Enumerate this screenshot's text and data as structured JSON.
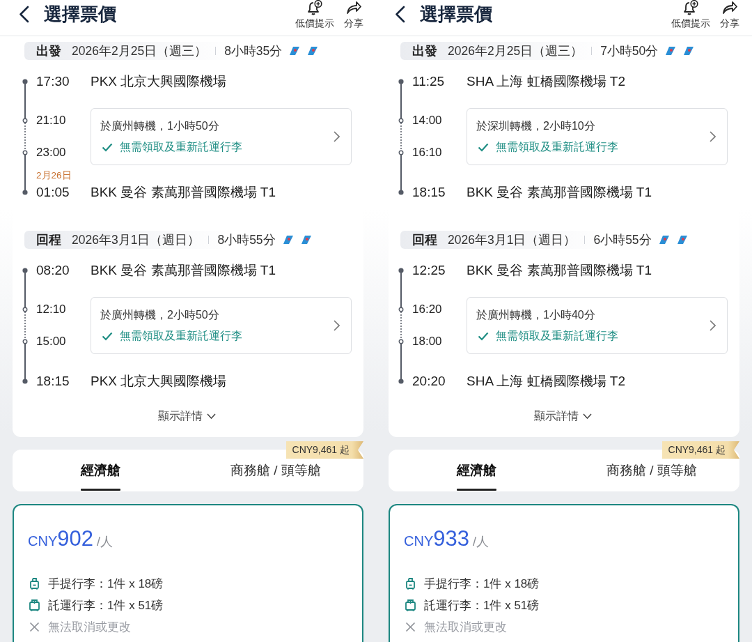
{
  "panels": [
    {
      "header": {
        "title": "選擇票價",
        "actions": [
          {
            "kind": "alert",
            "label": "低價提示"
          },
          {
            "kind": "share",
            "label": "分享"
          }
        ]
      },
      "legs": [
        {
          "label": "出發",
          "date": "2026年2月25日（週三）",
          "duration": "8小時35分",
          "depart": {
            "time": "17:30",
            "airport": "PKX 北京大興國際機場"
          },
          "transfer": {
            "arrive_time": "21:10",
            "depart_time": "23:00",
            "text": "於廣州轉機，1小時50分",
            "note": "無需領取及重新託運行李"
          },
          "arrive": {
            "date_note": "2月26日",
            "time": "01:05",
            "airport": "BKK 曼谷 素萬那普國際機場 T1"
          }
        },
        {
          "label": "回程",
          "date": "2026年3月1日（週日）",
          "duration": "8小時55分",
          "depart": {
            "time": "08:20",
            "airport": "BKK 曼谷 素萬那普國際機場 T1"
          },
          "transfer": {
            "arrive_time": "12:10",
            "depart_time": "15:00",
            "text": "於廣州轉機，2小時50分",
            "note": "無需領取及重新託運行李"
          },
          "arrive": {
            "time": "18:15",
            "airport": "PKX 北京大興國際機場"
          }
        }
      ],
      "details_link": "顯示詳情",
      "cabin_tabs": [
        {
          "label": "經濟艙",
          "selected": true
        },
        {
          "label": "商務艙 / 頭等艙",
          "selected": false
        }
      ],
      "cabin_badge": "CNY9,461 起",
      "fare": {
        "currency": "CNY",
        "amount": "902",
        "unit": "/人",
        "items": [
          {
            "kind": "carry_on",
            "text": "手提行李：1件 x 18磅"
          },
          {
            "kind": "checked_bag",
            "text": "託運行李：1件 x 51磅"
          },
          {
            "kind": "no_change",
            "text": "無法取消或更改"
          }
        ]
      }
    },
    {
      "header": {
        "title": "選擇票價",
        "actions": [
          {
            "kind": "alert",
            "label": "低價提示"
          },
          {
            "kind": "share",
            "label": "分享"
          }
        ]
      },
      "legs": [
        {
          "label": "出發",
          "date": "2026年2月25日（週三）",
          "duration": "7小時50分",
          "depart": {
            "time": "11:25",
            "airport": "SHA 上海 虹橋國際機場 T2"
          },
          "transfer": {
            "arrive_time": "14:00",
            "depart_time": "16:10",
            "text": "於深圳轉機，2小時10分",
            "note": "無需領取及重新託運行李"
          },
          "arrive": {
            "time": "18:15",
            "airport": "BKK 曼谷 素萬那普國際機場 T1"
          }
        },
        {
          "label": "回程",
          "date": "2026年3月1日（週日）",
          "duration": "6小時55分",
          "depart": {
            "time": "12:25",
            "airport": "BKK 曼谷 素萬那普國際機場 T1"
          },
          "transfer": {
            "arrive_time": "16:20",
            "depart_time": "18:00",
            "text": "於廣州轉機，1小時40分",
            "note": "無需領取及重新託運行李"
          },
          "arrive": {
            "time": "20:20",
            "airport": "SHA 上海 虹橋國際機場 T2"
          }
        }
      ],
      "details_link": "顯示詳情",
      "cabin_tabs": [
        {
          "label": "經濟艙",
          "selected": true
        },
        {
          "label": "商務艙 / 頭等艙",
          "selected": false
        }
      ],
      "cabin_badge": "CNY9,461 起",
      "fare": {
        "currency": "CNY",
        "amount": "933",
        "unit": "/人",
        "items": [
          {
            "kind": "carry_on",
            "text": "手提行李：1件 x 18磅"
          },
          {
            "kind": "checked_bag",
            "text": "託運行李：1件 x 51磅"
          },
          {
            "kind": "no_change",
            "text": "無法取消或更改"
          }
        ]
      }
    }
  ]
}
